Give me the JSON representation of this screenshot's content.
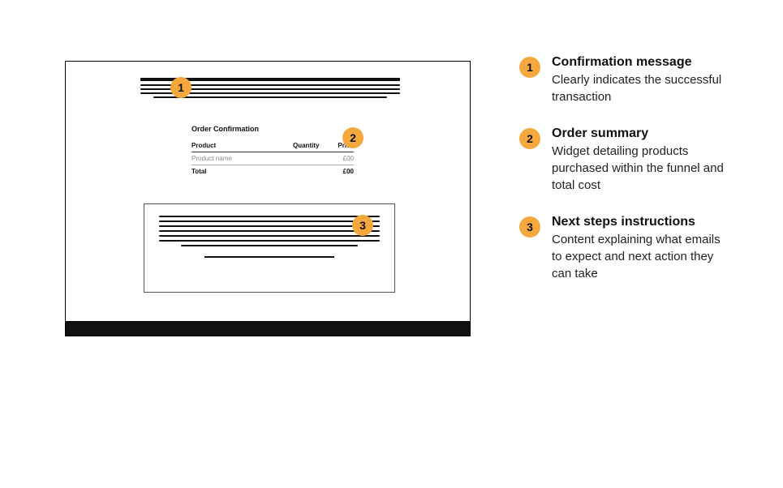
{
  "markers": {
    "one": "1",
    "two": "2",
    "three": "3"
  },
  "order": {
    "title": "Order Confirmation",
    "header": {
      "product": "Product",
      "quantity": "Quantity",
      "price": "Price"
    },
    "row": {
      "name": "Product name",
      "price": "£00"
    },
    "total": {
      "label": "Total",
      "price": "£00"
    }
  },
  "legend": [
    {
      "num": "1",
      "title": "Confirmation message",
      "desc": "Clearly indicates the successful transaction"
    },
    {
      "num": "2",
      "title": "Order summary",
      "desc": "Widget detailing products purchased within the funnel and total cost"
    },
    {
      "num": "3",
      "title": "Next steps instructions",
      "desc": "Content explaining what emails to expect and next action they can take"
    }
  ]
}
